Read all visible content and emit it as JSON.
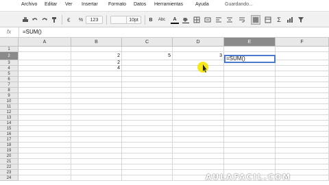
{
  "menu": {
    "items": [
      "Archivo",
      "Editar",
      "Ver",
      "Insertar",
      "Formato",
      "Datos",
      "Herramientas",
      "Ayuda"
    ],
    "status": "Guardando..."
  },
  "toolbar": {
    "percent": "%",
    "number_format": "123",
    "font_size": "10pt",
    "bold": "B",
    "italic": "Abc",
    "text_color": "A",
    "sum": "Σ"
  },
  "formula_bar": {
    "fx_label": "fx",
    "value": "=SUM()"
  },
  "columns": [
    "A",
    "B",
    "C",
    "D",
    "E",
    "F"
  ],
  "selected_column": "E",
  "rows": [
    {
      "n": "1",
      "cells": [
        "",
        "",
        "",
        "",
        "",
        ""
      ]
    },
    {
      "n": "2",
      "cells": [
        "",
        "2",
        "5",
        "3",
        "",
        ""
      ]
    },
    {
      "n": "3",
      "cells": [
        "",
        "2",
        "",
        "",
        "",
        ""
      ]
    },
    {
      "n": "4",
      "cells": [
        "",
        "4",
        "",
        "",
        "",
        ""
      ]
    },
    {
      "n": "5",
      "cells": [
        "",
        "",
        "",
        "",
        "",
        ""
      ]
    },
    {
      "n": "6",
      "cells": [
        "",
        "",
        "",
        "",
        "",
        ""
      ]
    },
    {
      "n": "7",
      "cells": [
        "",
        "",
        "",
        "",
        "",
        ""
      ]
    },
    {
      "n": "8",
      "cells": [
        "",
        "",
        "",
        "",
        "",
        ""
      ]
    },
    {
      "n": "9",
      "cells": [
        "",
        "",
        "",
        "",
        "",
        ""
      ]
    },
    {
      "n": "10",
      "cells": [
        "",
        "",
        "",
        "",
        "",
        ""
      ]
    },
    {
      "n": "11",
      "cells": [
        "",
        "",
        "",
        "",
        "",
        ""
      ]
    },
    {
      "n": "12",
      "cells": [
        "",
        "",
        "",
        "",
        "",
        ""
      ]
    },
    {
      "n": "13",
      "cells": [
        "",
        "",
        "",
        "",
        "",
        ""
      ]
    },
    {
      "n": "14",
      "cells": [
        "",
        "",
        "",
        "",
        "",
        ""
      ]
    },
    {
      "n": "15",
      "cells": [
        "",
        "",
        "",
        "",
        "",
        ""
      ]
    },
    {
      "n": "16",
      "cells": [
        "",
        "",
        "",
        "",
        "",
        ""
      ]
    },
    {
      "n": "17",
      "cells": [
        "",
        "",
        "",
        "",
        "",
        ""
      ]
    },
    {
      "n": "18",
      "cells": [
        "",
        "",
        "",
        "",
        "",
        ""
      ]
    },
    {
      "n": "19",
      "cells": [
        "",
        "",
        "",
        "",
        "",
        ""
      ]
    },
    {
      "n": "20",
      "cells": [
        "",
        "",
        "",
        "",
        "",
        ""
      ]
    },
    {
      "n": "21",
      "cells": [
        "",
        "",
        "",
        "",
        "",
        ""
      ]
    },
    {
      "n": "22",
      "cells": [
        "",
        "",
        "",
        "",
        "",
        ""
      ]
    },
    {
      "n": "23",
      "cells": [
        "",
        "",
        "",
        "",
        "",
        ""
      ]
    },
    {
      "n": "24",
      "cells": [
        "",
        "",
        "",
        "",
        "",
        ""
      ]
    }
  ],
  "selected_row": "2",
  "active_cell_editor": "=SUM()",
  "watermark": "AULAFACIL.COM",
  "colors": {
    "selection_border": "#4a78d0",
    "header_selected": "#8a8a8a",
    "cursor_highlight": "#f5e600"
  }
}
